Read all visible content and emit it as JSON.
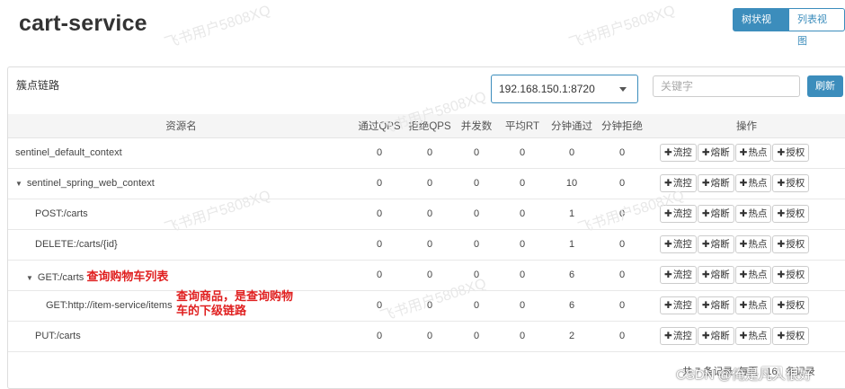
{
  "header": {
    "title": "cart-service",
    "views": [
      "树状视图",
      "列表视图"
    ]
  },
  "panel": {
    "title": "簇点链路",
    "machine_select": "192.168.150.1:8720",
    "search_placeholder": "关键字",
    "refresh_label": "刷新"
  },
  "table": {
    "columns": [
      "资源名",
      "通过QPS",
      "拒绝QPS",
      "并发数",
      "平均RT",
      "分钟通过",
      "分钟拒绝",
      "操作"
    ],
    "rows": [
      {
        "name": "sentinel_default_context",
        "pass_qps": "0",
        "block_qps": "0",
        "threads": "0",
        "avg_rt": "0",
        "min_pass": "0",
        "min_block": "0"
      },
      {
        "name": "sentinel_spring_web_context",
        "pass_qps": "0",
        "block_qps": "0",
        "threads": "0",
        "avg_rt": "0",
        "min_pass": "10",
        "min_block": "0"
      },
      {
        "name": "POST:/carts",
        "pass_qps": "0",
        "block_qps": "0",
        "threads": "0",
        "avg_rt": "0",
        "min_pass": "1",
        "min_block": "0"
      },
      {
        "name": "DELETE:/carts/{id}",
        "pass_qps": "0",
        "block_qps": "0",
        "threads": "0",
        "avg_rt": "0",
        "min_pass": "1",
        "min_block": "0"
      },
      {
        "name": "GET:/carts",
        "pass_qps": "0",
        "block_qps": "0",
        "threads": "0",
        "avg_rt": "0",
        "min_pass": "6",
        "min_block": "0"
      },
      {
        "name": "GET:http://item-service/items",
        "pass_qps": "0",
        "block_qps": "0",
        "threads": "0",
        "avg_rt": "0",
        "min_pass": "6",
        "min_block": "0"
      },
      {
        "name": "PUT:/carts",
        "pass_qps": "0",
        "block_qps": "0",
        "threads": "0",
        "avg_rt": "0",
        "min_pass": "2",
        "min_block": "0"
      }
    ],
    "ops": [
      "流控",
      "熔断",
      "热点",
      "授权"
    ]
  },
  "annotations": {
    "get_carts": "查询购物车列表",
    "get_items_line1": "查询商品，是查询购物",
    "get_items_line2": "车的下级链路"
  },
  "footer": {
    "summary": "共 7 条记录, 每页",
    "page_size": "16",
    "suffix": "条记录"
  },
  "watermarks": [
    "飞书用户5808XQ"
  ],
  "signature": "CSDN @俺是凡人很好"
}
